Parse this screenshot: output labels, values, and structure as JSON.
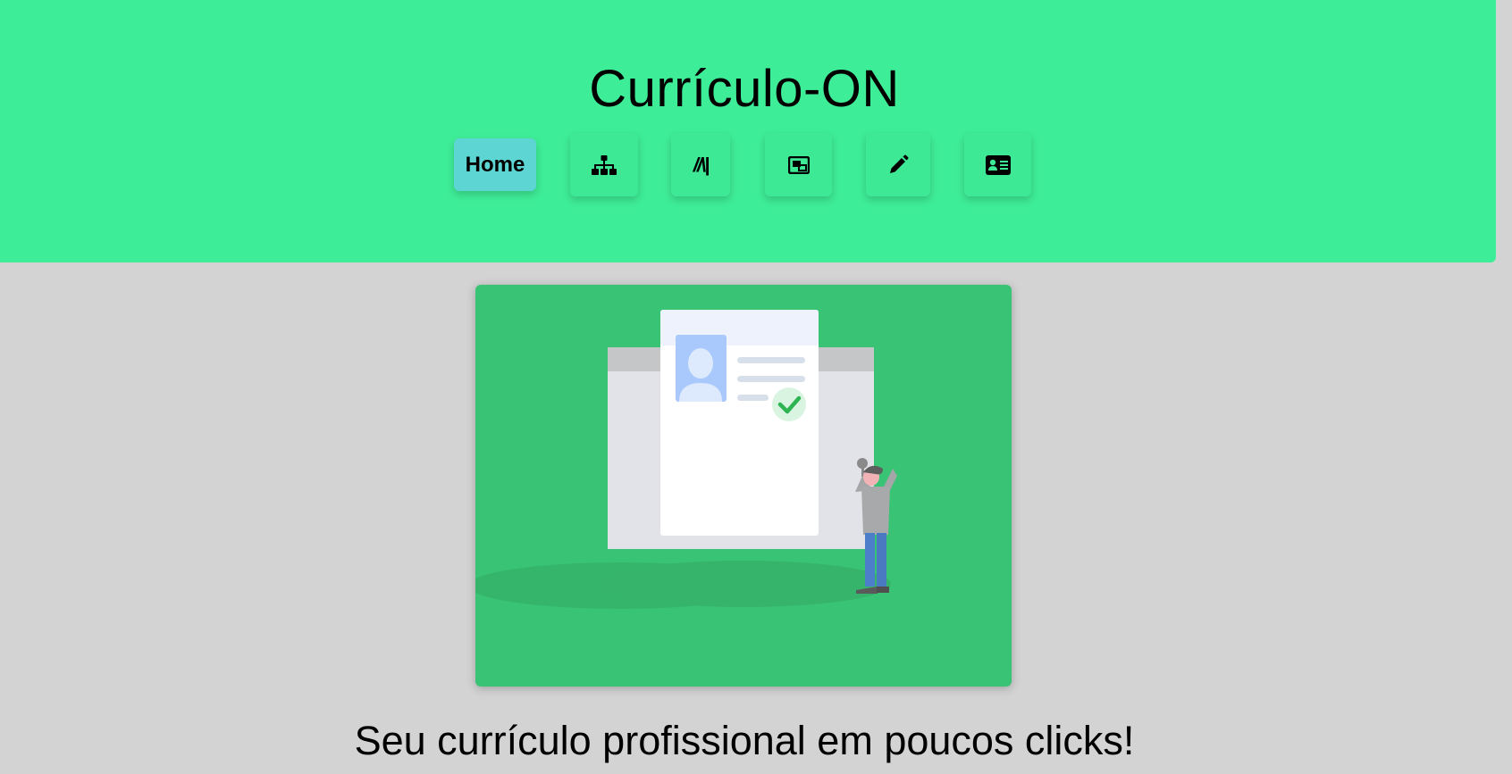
{
  "header": {
    "title": "Currículo-ON",
    "background": "#3eed97"
  },
  "nav": {
    "items": [
      {
        "label": "Home",
        "active": true
      },
      {
        "icon": "sitemap-icon"
      },
      {
        "icon": "book-slash-icon",
        "glyph": "//\\|"
      },
      {
        "icon": "portrait-icon"
      },
      {
        "icon": "pencil-icon"
      },
      {
        "icon": "id-card-icon"
      }
    ],
    "active_color": "#5cd5d3"
  },
  "hero": {
    "illustration": "resume-illustration",
    "background": "#39c374"
  },
  "tagline": "Seu currículo profissional em poucos clicks!"
}
